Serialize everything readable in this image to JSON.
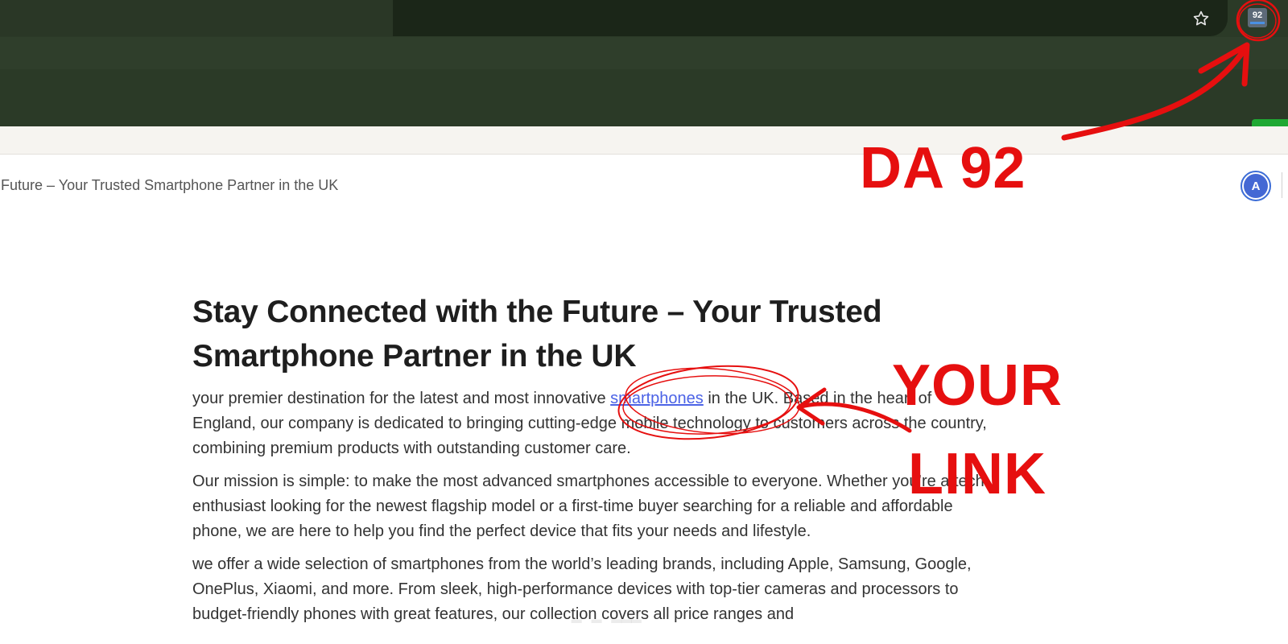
{
  "browser": {
    "star_icon": "star-icon",
    "extension_badge": "92"
  },
  "site": {
    "header_title": "e Future – Your Trusted Smartphone Partner in the UK",
    "avatar_initial": "A"
  },
  "article": {
    "title": "Stay Connected with the Future – Your Trusted Smartphone Partner in the UK",
    "p1_before": "your premier destination for the latest and most innovative ",
    "p1_link": "smartphones",
    "p1_after": " in the UK. Based in the heart of England, our company is dedicated to bringing cutting-edge mobile technology to customers across the country, combining premium products with outstanding customer care.",
    "p2": "Our mission is simple: to make the most advanced smartphones accessible to everyone. Whether you’re a tech enthusiast looking for the newest flagship model or a first-time buyer searching for a reliable and affordable phone, we are here to help you find the perfect device that fits your needs and lifestyle.",
    "p3": "we offer a wide selection of smartphones from the world’s leading brands, including Apple, Samsung, Google, OnePlus, Xiaomi, and more. From sleek, high-performance devices with top-tier cameras and processors to budget-friendly phones with great features, our collection covers all price ranges and"
  },
  "annotations": {
    "da_label": "DA 92",
    "your_label": "YOUR",
    "link_label": "LINK",
    "color": "#e60f0f"
  }
}
